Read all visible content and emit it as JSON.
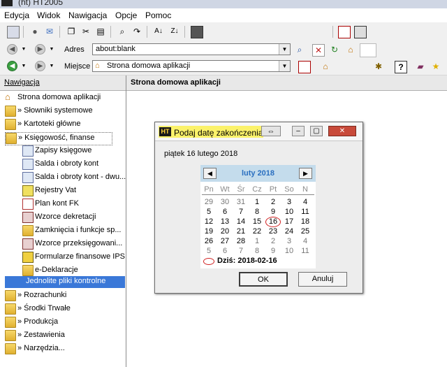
{
  "window": {
    "title": "(ht) HT2005"
  },
  "menu": [
    "Edycja",
    "Widok",
    "Nawigacja",
    "Opcje",
    "Pomoc"
  ],
  "address": {
    "label": "Adres",
    "value": "about:blank"
  },
  "place": {
    "label": "Miejsce",
    "value": "Strona domowa aplikacji"
  },
  "nav": {
    "header": "Nawigacja",
    "items": [
      "Strona domowa aplikacji",
      "» Słowniki systemowe",
      "» Kartoteki główne",
      "» Księgowość, finanse",
      "Zapisy księgowe",
      "Salda i obroty kont",
      "Salda i obroty kont - dwu...",
      "Rejestry Vat",
      "Plan kont FK",
      "Wzorce dekretacji",
      "Zamknięcia i funkcje sp...",
      "Wzorce przeksięgowani...",
      "Formularze finansowe IPS",
      "e-Deklaracje",
      "Jednolite pliki kontrolne",
      "» Rozrachunki",
      "» Środki Trwałe",
      "» Produkcja",
      "» Zestawienia",
      "» Narzędzia..."
    ]
  },
  "content": {
    "header": "Strona domowa aplikacji"
  },
  "dialog": {
    "title": "Podaj datę zakończenia",
    "app_badge": "HT",
    "date_text": "piątek 16 lutego 2018",
    "calendar": {
      "month": "luty 2018",
      "weekdays": [
        "Pn",
        "Wt",
        "Śr",
        "Cz",
        "Pt",
        "So",
        "N"
      ],
      "weeks": [
        [
          "29",
          "30",
          "31",
          "1",
          "2",
          "3",
          "4"
        ],
        [
          "5",
          "6",
          "7",
          "8",
          "9",
          "10",
          "11"
        ],
        [
          "12",
          "13",
          "14",
          "15",
          "16",
          "17",
          "18"
        ],
        [
          "19",
          "20",
          "21",
          "22",
          "23",
          "24",
          "25"
        ],
        [
          "26",
          "27",
          "28",
          "1",
          "2",
          "3",
          "4"
        ],
        [
          "5",
          "6",
          "7",
          "8",
          "9",
          "10",
          "11"
        ]
      ],
      "today_label": "Dziś: 2018-02-16"
    },
    "ok_label": "OK",
    "cancel_label": "Anuluj"
  }
}
